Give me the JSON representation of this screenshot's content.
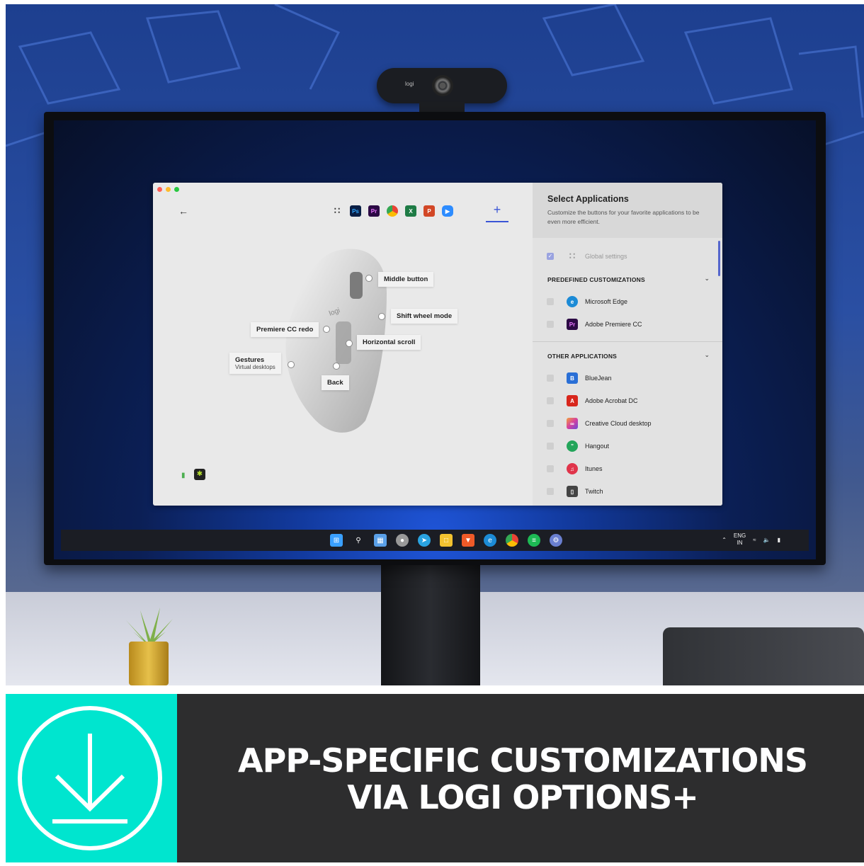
{
  "webcam": {
    "brand": "logi"
  },
  "app": {
    "tabs": [
      {
        "name": "global-settings",
        "icon": "grid-icon"
      },
      {
        "name": "photoshop",
        "label": "Ps",
        "color": "#0a1f45"
      },
      {
        "name": "premiere",
        "label": "Pr",
        "color": "#2c0a45"
      },
      {
        "name": "chrome",
        "icon": "chrome-icon"
      },
      {
        "name": "excel",
        "label": "X",
        "color": "#1e7b45"
      },
      {
        "name": "powerpoint",
        "label": "P",
        "color": "#d24726"
      },
      {
        "name": "zoom",
        "icon": "zoom-icon",
        "color": "#2d8cff"
      }
    ],
    "add_tab": "+",
    "callouts": {
      "middle_button": "Middle button",
      "shift_wheel": "Shift wheel mode",
      "premiere_redo": "Premiere CC redo",
      "horizontal_scroll": "Horizontal scroll",
      "gestures": "Gestures",
      "gestures_sub": "Virtual desktops",
      "back": "Back"
    },
    "mouse_logo": "logi",
    "panel": {
      "title": "Select Applications",
      "description": "Customize the buttons for your favorite applications to be even more efficient.",
      "global": "Global settings",
      "predefined_heading": "PREDEFINED CUSTOMIZATIONS",
      "predefined": [
        {
          "label": "Microsoft Edge",
          "icon": "edge-icon",
          "color": "#1c8bd6"
        },
        {
          "label": "Adobe Premiere CC",
          "icon": "premiere-icon",
          "color": "#2c0a45"
        }
      ],
      "other_heading": "OTHER APPLICATIONS",
      "other": [
        {
          "label": "BlueJean",
          "icon": "bluejeans-icon",
          "color": "#2a6fd6"
        },
        {
          "label": "Adobe Acrobat DC",
          "icon": "acrobat-icon",
          "color": "#d8261c"
        },
        {
          "label": "Creative Cloud desktop",
          "icon": "creative-cloud-icon",
          "color": "#d43fa0"
        },
        {
          "label": "Hangout",
          "icon": "hangouts-icon",
          "color": "#23a55a"
        },
        {
          "label": "Itunes",
          "icon": "itunes-icon",
          "color": "#e0344a"
        },
        {
          "label": "Twitch",
          "icon": "twitch-icon",
          "color": "#444444"
        }
      ]
    }
  },
  "taskbar": {
    "lang_top": "ENG",
    "lang_bottom": "IN"
  },
  "banner": {
    "line1": "APP-SPECIFIC CUSTOMIZATIONS",
    "line2": "VIA LOGI OPTIONS+",
    "accent": "#00e5cf"
  }
}
